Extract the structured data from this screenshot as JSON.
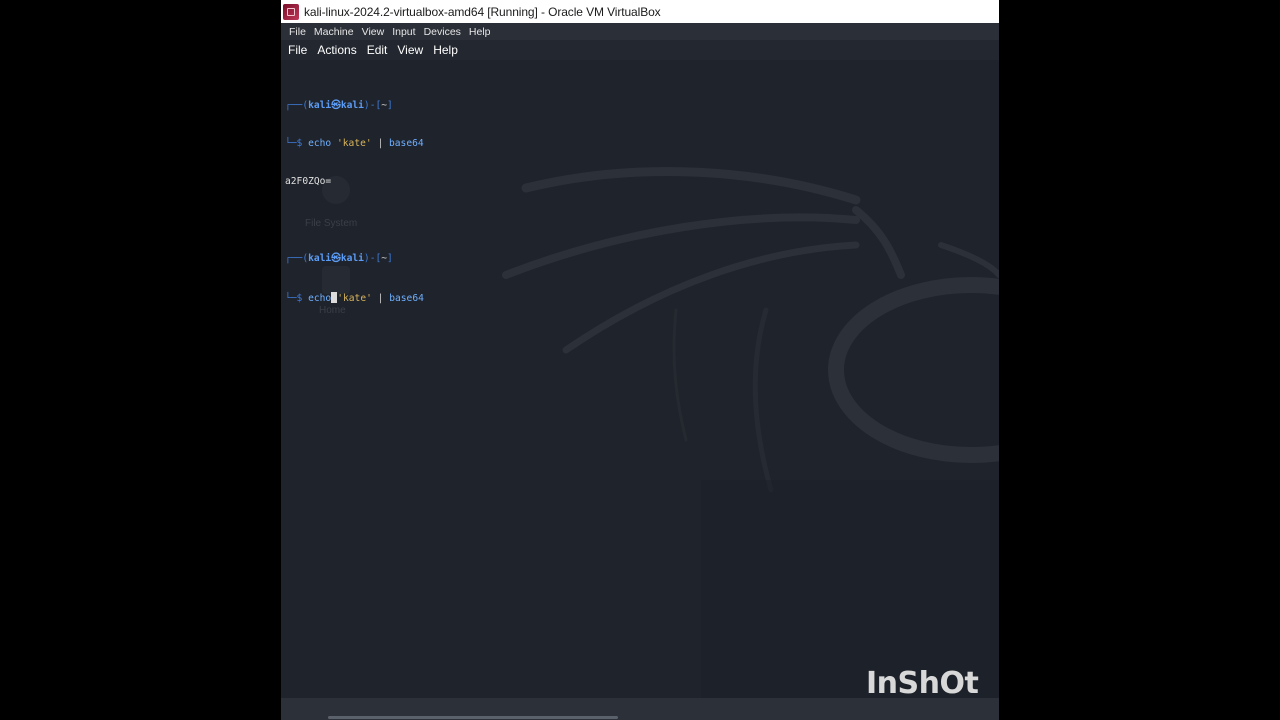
{
  "window": {
    "title": "kali-linux-2024.2-virtualbox-amd64 [Running] - Oracle VM VirtualBox",
    "menu": [
      "File",
      "Machine",
      "View",
      "Input",
      "Devices",
      "Help"
    ]
  },
  "terminal": {
    "menu": [
      "File",
      "Actions",
      "Edit",
      "View",
      "Help"
    ],
    "prompt": {
      "open": "┌──(",
      "user": "kali",
      "at": "㉿",
      "host": "kali",
      "close": ")-[",
      "dir": "~",
      "end": "]",
      "dollar_prefix": "└─$ "
    },
    "lines": [
      {
        "cmd": "echo",
        "arg": "'kate'",
        "pipe": "|",
        "tool": "base64"
      },
      {
        "output": "a2F0ZQo="
      },
      {
        "cmd": "echo",
        "arg": "'kate'",
        "pipe": "|",
        "tool": "base64"
      }
    ]
  },
  "desktop": {
    "icons": [
      "File System",
      "Home"
    ]
  },
  "watermark": "InShOt",
  "colors": {
    "terminal_bg": "#1f232b",
    "prompt_blue": "#5c9cf5",
    "string_yellow": "#d7b45c"
  }
}
